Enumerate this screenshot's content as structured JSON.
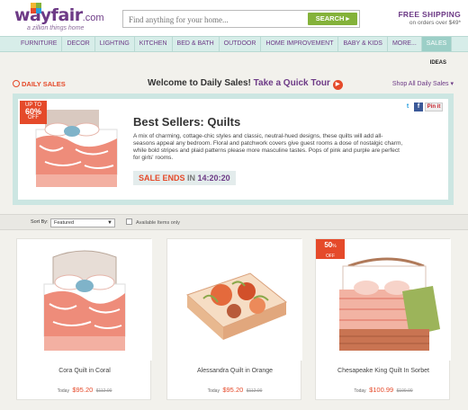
{
  "header": {
    "logo_word": "wayfair",
    "logo_dotcom": ".com",
    "logo_tagline": "a zillion things home",
    "search_placeholder": "Find anything for your home...",
    "search_button": "SEARCH ▸",
    "shipping_title": "FREE SHIPPING",
    "shipping_sub": "on orders over $49*"
  },
  "nav": {
    "items": [
      "FURNITURE",
      "DECOR",
      "LIGHTING",
      "KITCHEN",
      "BED & BATH",
      "OUTDOOR",
      "HOME IMPROVEMENT",
      "BABY & KIDS",
      "MORE...",
      "SALES"
    ],
    "ideas": "IDEAS"
  },
  "daily_sales": {
    "logo": "DAILY SALES",
    "welcome": "Welcome to Daily Sales!",
    "tour": "Take a Quick Tour",
    "shop_all": "Shop All Daily Sales ▾"
  },
  "featured": {
    "badge_top": "UP TO",
    "badge_pct": "60%",
    "badge_bottom": "OFF",
    "title": "Best Sellers: Quilts",
    "description": "A mix of charming, cottage-chic styles and classic, neutral-hued designs, these quilts will add all-seasons appeal any bedroom. Floral and patchwork covers give guest rooms a dose of nostalgic charm, while bold stripes and plaid patterns please more masculine tastes. Pops of pink and purple are perfect for girls' rooms.",
    "ends_label": "SALE ENDS",
    "ends_in": "IN",
    "ends_time": "14:20:20",
    "share_pin": "Pin it"
  },
  "sort": {
    "label": "Sort By:",
    "selected": "Featured",
    "available_only": "Available Items only"
  },
  "products": [
    {
      "name": "Cora Quilt in Coral",
      "today": "Today",
      "price": "$95.20",
      "was": "$112.00"
    },
    {
      "name": "Alessandra Quilt in Orange",
      "today": "Today",
      "price": "$95.20",
      "was": "$112.00"
    },
    {
      "name": "Chesapeake King Quilt In Sorbet",
      "today": "Today",
      "price": "$100.99",
      "was": "$199.99",
      "badge_pct": "50",
      "badge_off": "OFF"
    }
  ],
  "colors": {
    "brand_purple": "#6d3a86",
    "accent_red": "#e54a2a",
    "search_green": "#84b23a",
    "nav_teal": "#d7ede9"
  }
}
